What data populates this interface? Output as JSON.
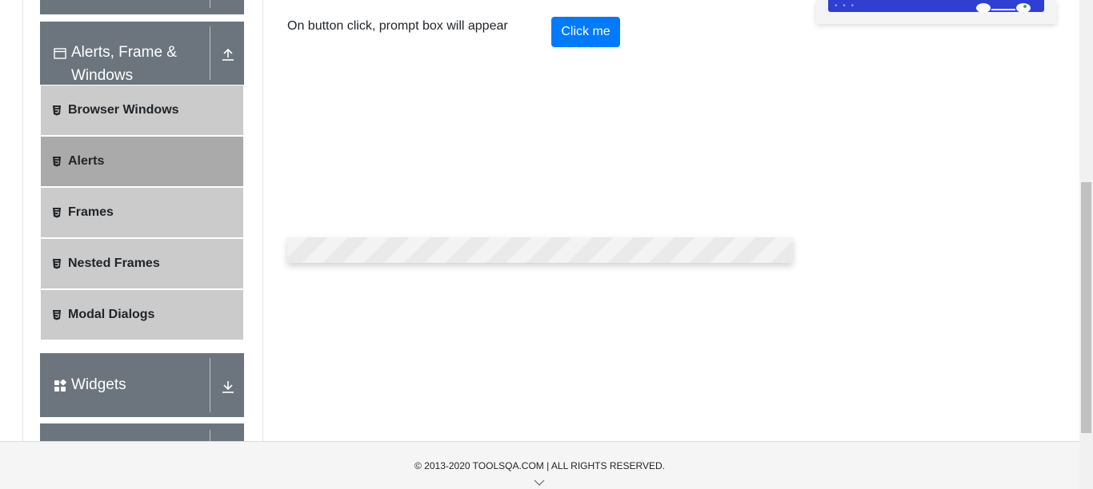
{
  "sidebar": {
    "groups": [
      {
        "label": "",
        "icon": "chevron-up-icon",
        "state": "collapsed"
      },
      {
        "label": "Alerts, Frame & Windows",
        "line1": "Alerts, Frame &",
        "line2": "Windows",
        "icon": "window-icon",
        "toggle_icon": "arrow-up-icon"
      },
      {
        "label": "Widgets",
        "icon": "widgets-icon",
        "toggle_icon": "arrow-down-icon"
      },
      {
        "label": "",
        "icon": "",
        "state": "collapsed"
      }
    ],
    "items": [
      {
        "label": "Browser Windows",
        "active": false
      },
      {
        "label": "Alerts",
        "active": true
      },
      {
        "label": "Frames",
        "active": false
      },
      {
        "label": "Nested Frames",
        "active": false
      },
      {
        "label": "Modal Dialogs",
        "active": false
      }
    ]
  },
  "main": {
    "prompt_text": "On button click, prompt box will appear",
    "button_label": "Click me"
  },
  "footer": {
    "copyright": "© 2013-2020 TOOLSQA.COM | ALL RIGHTS RESERVED."
  },
  "colors": {
    "group_header": "#6c757d",
    "menu_item": "#cbcbcb",
    "menu_item_active": "#aaaaaa",
    "button": "#007bff"
  }
}
